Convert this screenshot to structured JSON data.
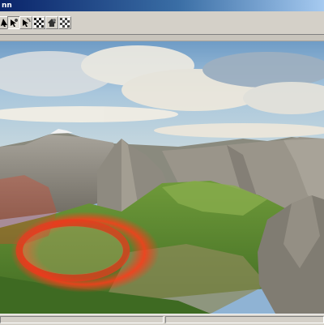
{
  "window": {
    "title": "nn"
  },
  "toolbar": {
    "tools": [
      {
        "name": "pointer-tool"
      },
      {
        "name": "grab-tool",
        "pressed": true
      },
      {
        "name": "rotate-tool"
      },
      {
        "name": "checker-tool-1"
      },
      {
        "name": "sculpt-tool"
      },
      {
        "name": "checker-tool-2"
      }
    ]
  },
  "colors": {
    "title_bar": "#0a246a",
    "panel": "#d4d0c8",
    "selection_ring": "#e83a1e"
  }
}
